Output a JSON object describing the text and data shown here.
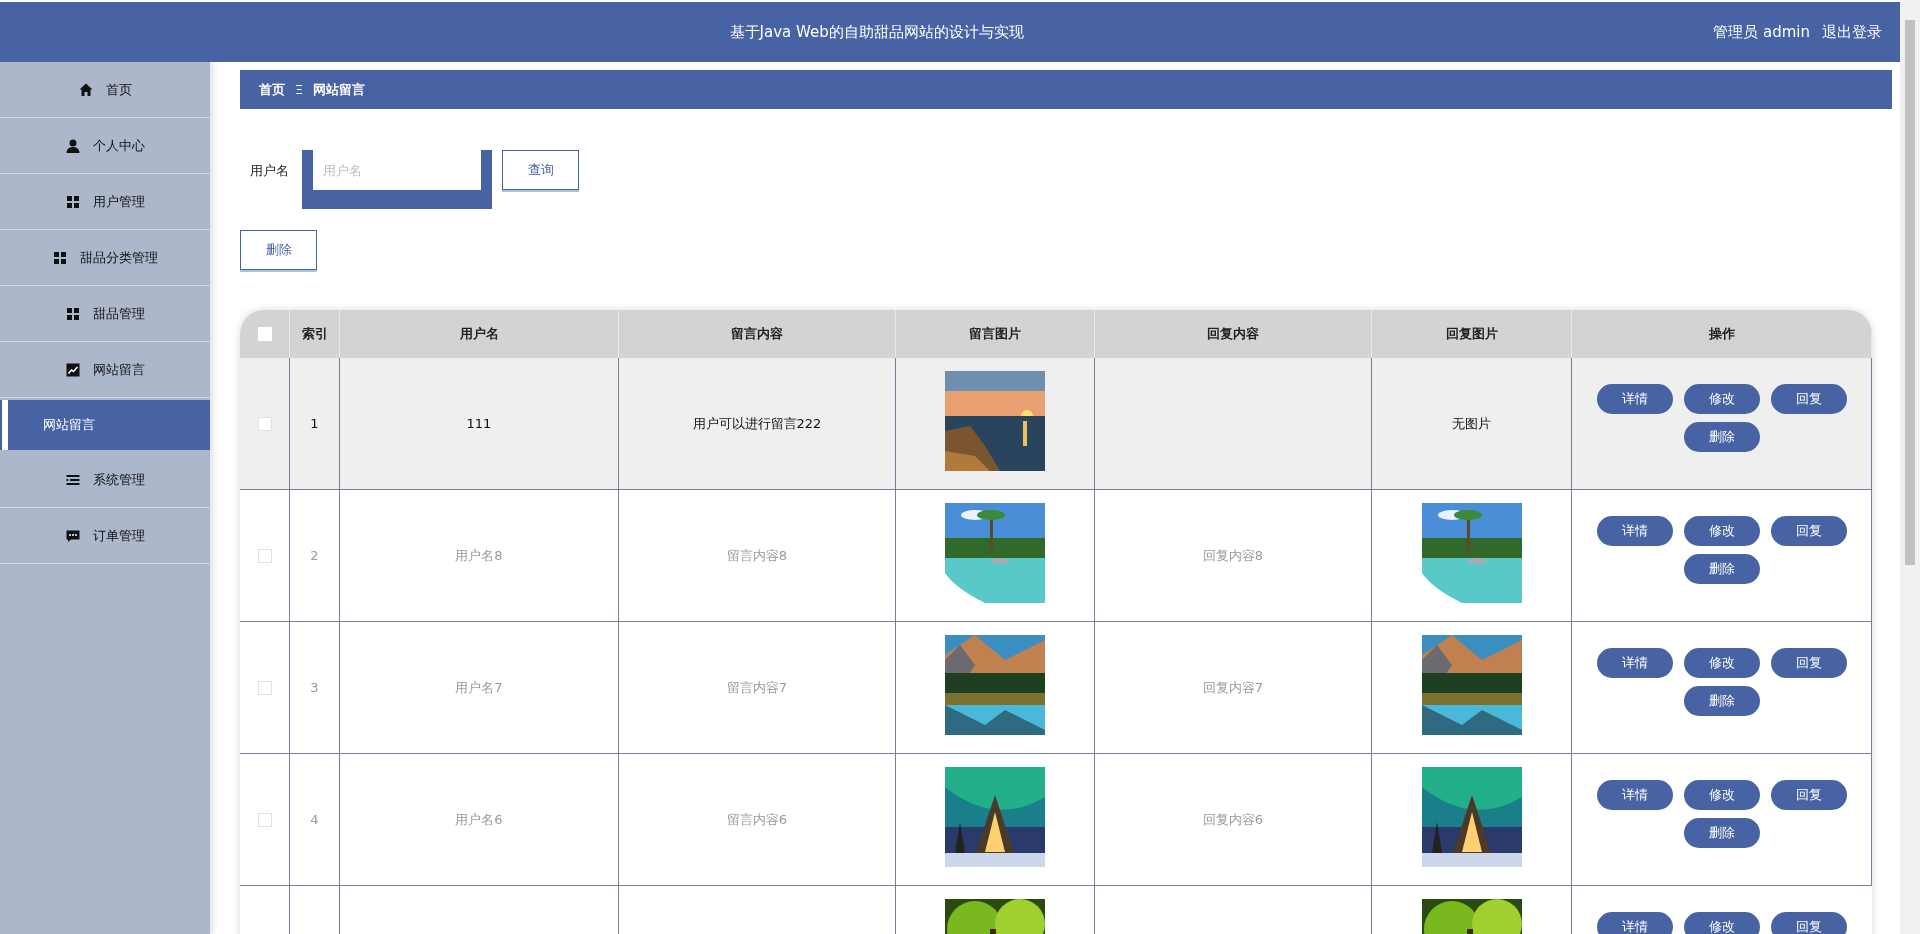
{
  "header": {
    "title": "基于Java Web的自助甜品网站的设计与实现",
    "user": "管理员 admin",
    "logout": "退出登录"
  },
  "sidebar": {
    "items": [
      {
        "label": "首页",
        "selected": false
      },
      {
        "label": "个人中心",
        "selected": false
      },
      {
        "label": "用户管理",
        "selected": false
      },
      {
        "label": "甜品分类管理",
        "selected": false
      },
      {
        "label": "甜品管理",
        "selected": false
      },
      {
        "label": "网站留言",
        "selected": false,
        "children": [
          {
            "label": "网站留言",
            "selected": true
          }
        ]
      },
      {
        "label": "系统管理",
        "selected": false
      },
      {
        "label": "订单管理",
        "selected": false
      }
    ]
  },
  "breadcrumb": {
    "home": "首页",
    "separator": "Ξ",
    "current": "网站留言"
  },
  "search": {
    "label": "用户名",
    "placeholder": "用户名",
    "button": "查询"
  },
  "delete_button": "删除",
  "table": {
    "select_all": {
      "checked": false
    },
    "columns": [
      "索引",
      "用户名",
      "留言内容",
      "留言图片",
      "回复内容",
      "回复图片",
      "操作"
    ],
    "rows": [
      {
        "checked": false,
        "highlighted": true,
        "index": "1",
        "username": "111",
        "content": "用户可以进行留言222",
        "image": {
          "kind": "picture"
        },
        "reply_image_text": "无图片",
        "actions": [
          "详情",
          "修改",
          "回复",
          "删除"
        ]
      },
      {
        "checked": false,
        "highlighted": false,
        "index": "2",
        "username": "用户名8",
        "content": "留言内容8",
        "image": {
          "kind": "picture"
        },
        "reply": "回复内容8",
        "reply_image": {
          "kind": "picture"
        },
        "actions": [
          "详情",
          "修改",
          "回复",
          "删除"
        ]
      },
      {
        "checked": false,
        "highlighted": false,
        "index": "3",
        "username": "用户名7",
        "content": "留言内容7",
        "image": {
          "kind": "picture"
        },
        "reply": "回复内容7",
        "reply_image": {
          "kind": "picture"
        },
        "actions": [
          "详情",
          "修改",
          "回复",
          "删除"
        ]
      },
      {
        "checked": false,
        "highlighted": false,
        "index": "4",
        "username": "用户名6",
        "content": "留言内容6",
        "image": {
          "kind": "picture"
        },
        "reply": "回复内容6",
        "reply_image": {
          "kind": "picture"
        },
        "actions": [
          "详情",
          "修改",
          "回复",
          "删除"
        ]
      },
      {
        "highlighted": false,
        "image": {
          "kind": "picture"
        },
        "reply_image": {
          "kind": "picture"
        },
        "actions": [
          "详情",
          "修改",
          "回复"
        ]
      }
    ]
  }
}
